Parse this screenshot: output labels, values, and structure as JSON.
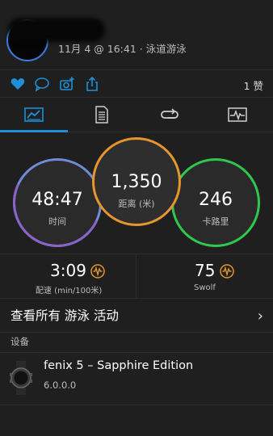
{
  "activity": {
    "meta": "11月 4 @ 16:41 · 泳道游泳"
  },
  "actions": {
    "likes": "1 赞"
  },
  "summary": {
    "time_value": "48:47",
    "time_label": "时间",
    "distance_value": "1,350",
    "distance_label": "距离 (米)",
    "calories_value": "246",
    "calories_label": "卡路里"
  },
  "stats": {
    "pace_value": "3:09",
    "pace_label": "配速 (min/100米)",
    "swolf_value": "75",
    "swolf_label": "Swolf"
  },
  "view_all": "查看所有 游泳 活动",
  "section": {
    "devices": "设备"
  },
  "device": {
    "name": "fenix 5 – Sapphire Edition",
    "version": "6.0.0.0"
  },
  "colors": {
    "accent": "#1e90d8",
    "distance": "#e5962d",
    "calories": "#2fc84f",
    "time": "#6f8ad8"
  }
}
